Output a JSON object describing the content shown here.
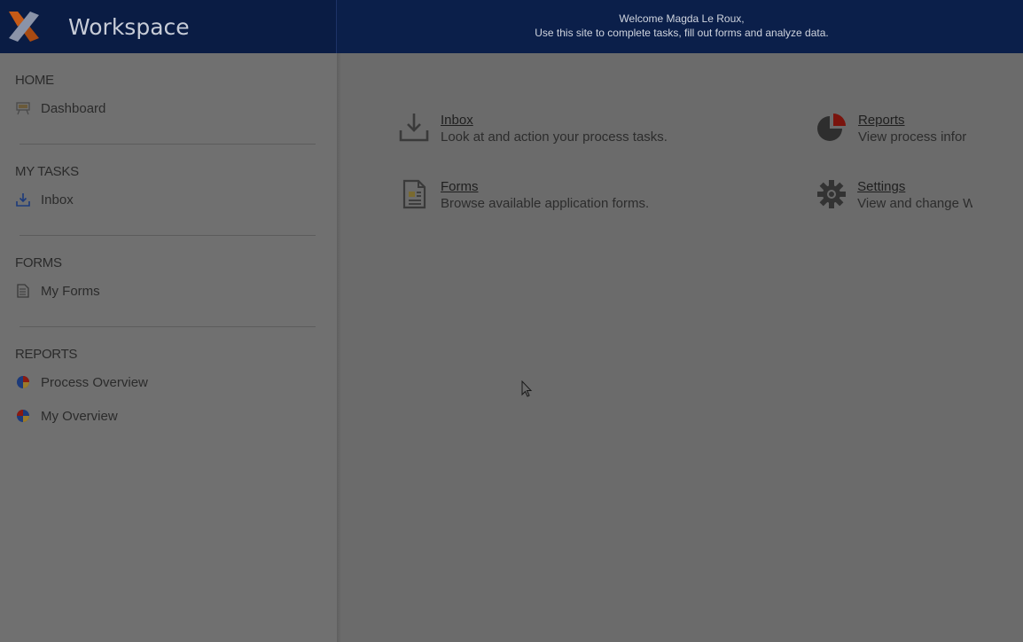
{
  "header": {
    "app_title": "Workspace",
    "welcome_line1": "Welcome Magda Le Roux,",
    "welcome_line2": "Use this site to complete tasks, fill out forms and analyze data.",
    "logo_colors": [
      "#d05a14",
      "#9aa3b8"
    ]
  },
  "sidebar": {
    "sections": [
      {
        "title": "HOME",
        "items": [
          {
            "label": "Dashboard",
            "icon": "dashboard-icon"
          }
        ]
      },
      {
        "title": "MY TASKS",
        "items": [
          {
            "label": "Inbox",
            "icon": "inbox-icon"
          }
        ]
      },
      {
        "title": "FORMS",
        "items": [
          {
            "label": "My Forms",
            "icon": "form-icon"
          }
        ]
      },
      {
        "title": "REPORTS",
        "items": [
          {
            "label": "Process Overview",
            "icon": "pie-chart-icon"
          },
          {
            "label": "My Overview",
            "icon": "pie-chart-icon"
          }
        ]
      }
    ]
  },
  "main": {
    "tiles": [
      {
        "title": "Inbox",
        "description": "Look at and action your process tasks.",
        "icon": "inbox-download-icon"
      },
      {
        "title": "Reports",
        "description": "View process infor",
        "icon": "pie-chart-icon"
      },
      {
        "title": "Forms",
        "description": "Browse available application forms.",
        "icon": "form-document-icon"
      },
      {
        "title": "Settings",
        "description": "View and change W",
        "icon": "gear-icon"
      }
    ]
  },
  "colors": {
    "header_bg": "#0b1f4a",
    "overlay_gray": "#6b6b6b",
    "accent_red": "#8b1a10",
    "accent_blue": "#1c3a7a"
  }
}
